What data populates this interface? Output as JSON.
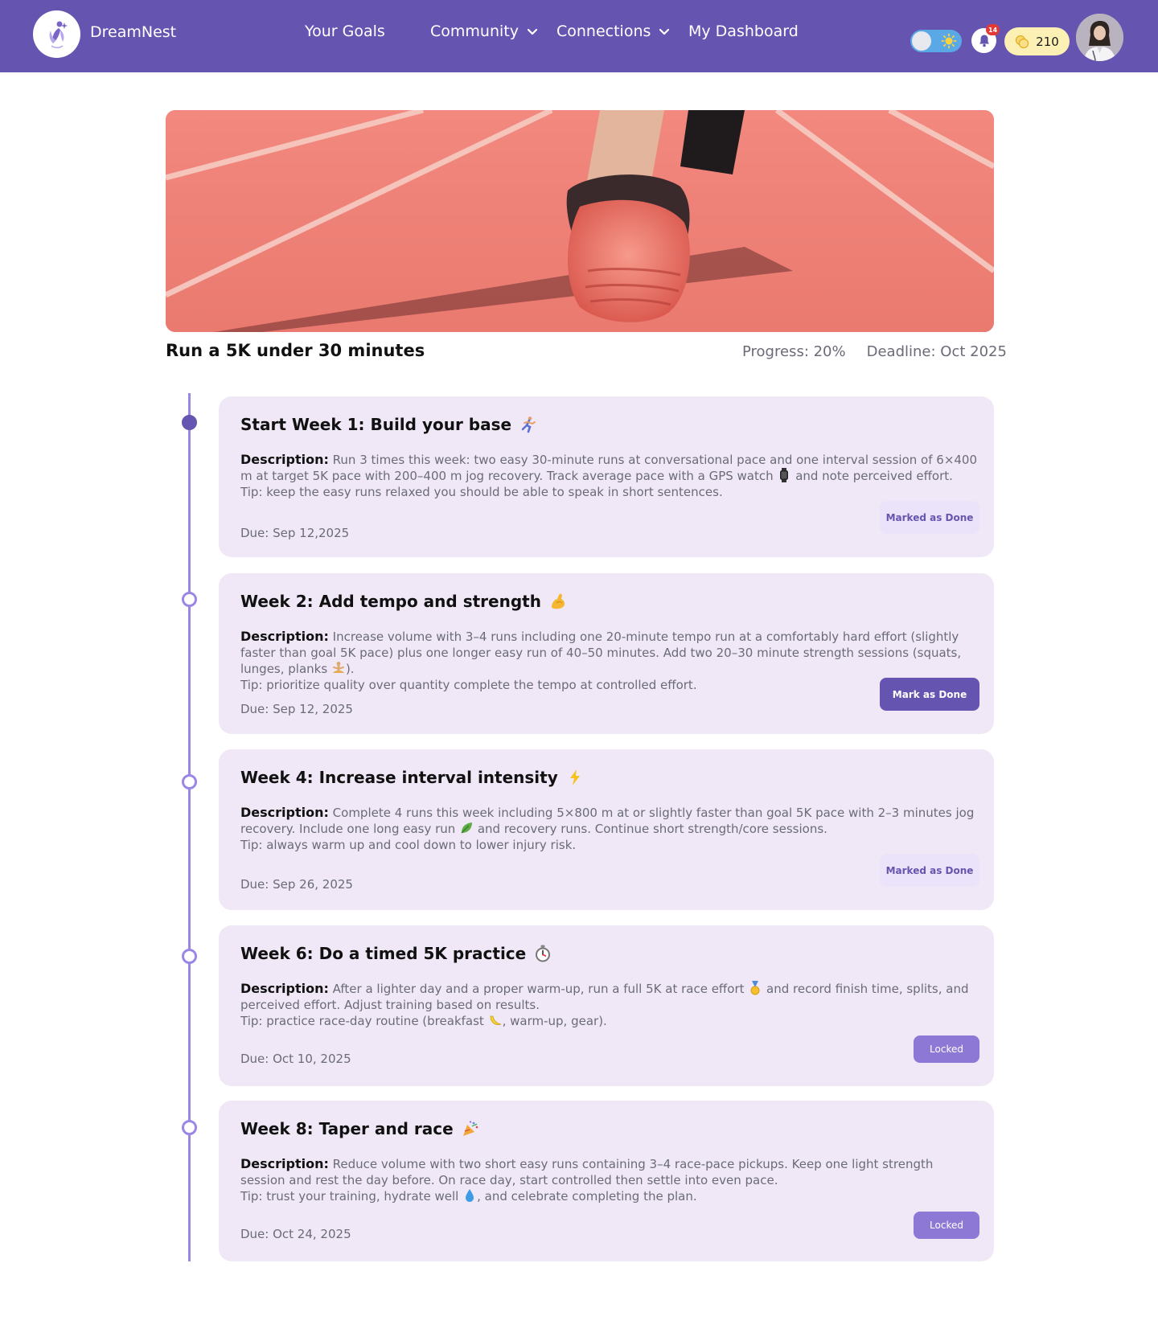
{
  "header": {
    "brand": "DreamNest",
    "nav": [
      {
        "label": "Your Goals",
        "dropdown": false
      },
      {
        "label": "Community",
        "dropdown": true
      },
      {
        "label": "Connections",
        "dropdown": true
      },
      {
        "label": "My Dashboard",
        "dropdown": false
      }
    ],
    "notifications_count": "14",
    "coins": "210"
  },
  "goal": {
    "title": "Run a 5K under 30 minutes",
    "progress_text": "Progress: 20%",
    "deadline_text": "Deadline: Oct 2025",
    "progress": 0.2
  },
  "steps": [
    {
      "title": "Start Week 1:  Build your base",
      "emoji_icon": "runner-icon",
      "desc_label": "Description:",
      "desc": "Run 3 times this week: two easy 30-minute runs at conversational pace and one interval session of 6×400 m at target 5K pace with 200–400 m jog recovery. Track average pace with a GPS watch",
      "desc_after_icon": " and note perceived effort.",
      "inline_icon": "watch-icon",
      "tip": "Tip: keep the easy runs relaxed you should be able to speak in short sentences.",
      "due": "Due: Sep 12,2025",
      "button": "Marked as Done",
      "state": "done"
    },
    {
      "title": "Week 2: Add tempo and strength",
      "emoji_icon": "flexed-arm-icon",
      "desc_label": "Description:",
      "desc": "Increase volume with 3–4 runs including one 20-minute tempo run at a comfortably hard effort (slightly faster than goal 5K pace) plus one longer easy run of 40–50 minutes. Add two 20–30 minute strength sessions (squats, lunges, planks",
      "desc_after_icon": ").",
      "inline_icon": "yoga-icon",
      "tip": "Tip: prioritize quality over quantity complete the tempo at controlled effort.",
      "due": "Due: Sep 12, 2025",
      "button": "Mark as Done",
      "state": "active"
    },
    {
      "title": "Week 4: Increase interval intensity",
      "emoji_icon": "lightning-icon",
      "desc_label": "Description:",
      "desc": "Complete 4 runs this week including 5×800 m at or slightly faster than goal 5K pace with 2–3 minutes jog recovery. Include one long easy run",
      "desc_after_icon": " and recovery runs. Continue short strength/core sessions.",
      "inline_icon": "leaf-icon",
      "tip": "Tip: always warm up and cool down to lower injury risk.",
      "due": "Due: Sep 26, 2025",
      "button": "Marked as Done",
      "state": "done"
    },
    {
      "title": "Week 6: Do a timed 5K practice",
      "emoji_icon": "stopwatch-icon",
      "desc_label": "Description:",
      "desc": "After a lighter day and a proper warm-up, run a full 5K at race effort",
      "desc_after_icon": " and record finish time, splits, and perceived effort. Adjust training based on results.",
      "inline_icon": "medal-icon",
      "tip": "Tip: practice race-day routine (breakfast",
      "tip_after_icon": ", warm-up, gear).",
      "tip_icon": "banana-icon",
      "due": "Due: Oct 10, 2025",
      "button": "Locked",
      "state": "locked"
    },
    {
      "title": "Week 8: Taper and race",
      "emoji_icon": "party-popper-icon",
      "desc_label": "Description:",
      "desc": "Reduce volume with two short easy runs containing 3–4 race-pace pickups. Keep one light strength session and rest the day before. On race day, start controlled then settle into even pace.",
      "tip": "Tip: trust your training, hydrate well",
      "tip_after_icon": ", and celebrate completing the plan.",
      "tip_icon": "droplet-icon",
      "due": "Due: Oct 24, 2025",
      "button": "Locked",
      "state": "locked"
    }
  ],
  "colors": {
    "primary": "#6655b0",
    "card_bg": "#f0e8f6",
    "timeline": "#9b86e6",
    "locked_button": "#8e78d6",
    "coins_bg": "#fdf0b5"
  }
}
